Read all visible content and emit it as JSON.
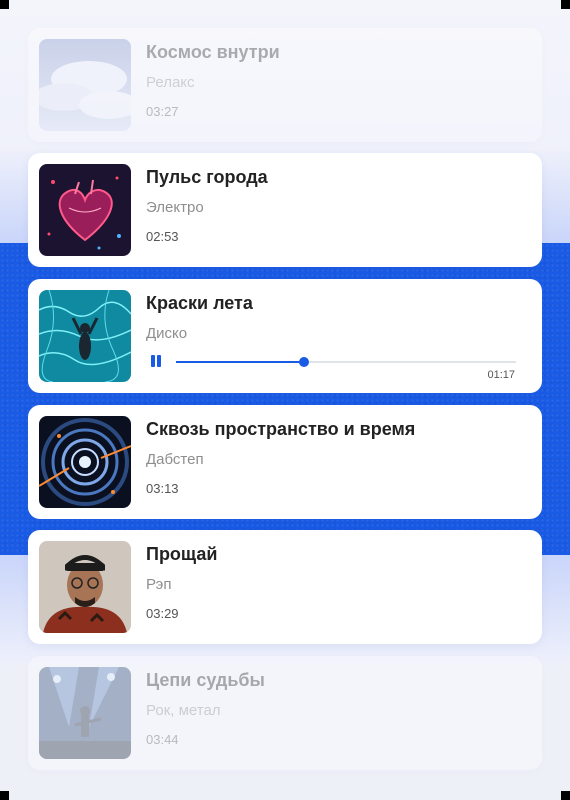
{
  "tracks": [
    {
      "title": "Космос внутри",
      "genre": "Релакс",
      "duration": "03:27",
      "cover": "clouds-cover"
    },
    {
      "title": "Пульс города",
      "genre": "Электро",
      "duration": "02:53",
      "cover": "neon-heart-cover"
    },
    {
      "title": "Краски лета",
      "genre": "Диско",
      "cover": "pool-swimmer-cover",
      "playing": true,
      "elapsed": "01:17",
      "progress": 0.375
    },
    {
      "title": "Сквозь пространство и время",
      "genre": "Дабстеп",
      "duration": "03:13",
      "cover": "tunnel-cover"
    },
    {
      "title": "Прощай",
      "genre": "Рэп",
      "duration": "03:29",
      "cover": "rapper-portrait-cover"
    },
    {
      "title": "Цепи судьбы",
      "genre": "Рок, метал",
      "duration": "03:44",
      "cover": "rock-concert-cover"
    }
  ],
  "colors": {
    "accent": "#1a5be6",
    "background": "#eef0f8",
    "card": "#ffffff"
  },
  "icons": {
    "player_control": "pause-icon"
  }
}
